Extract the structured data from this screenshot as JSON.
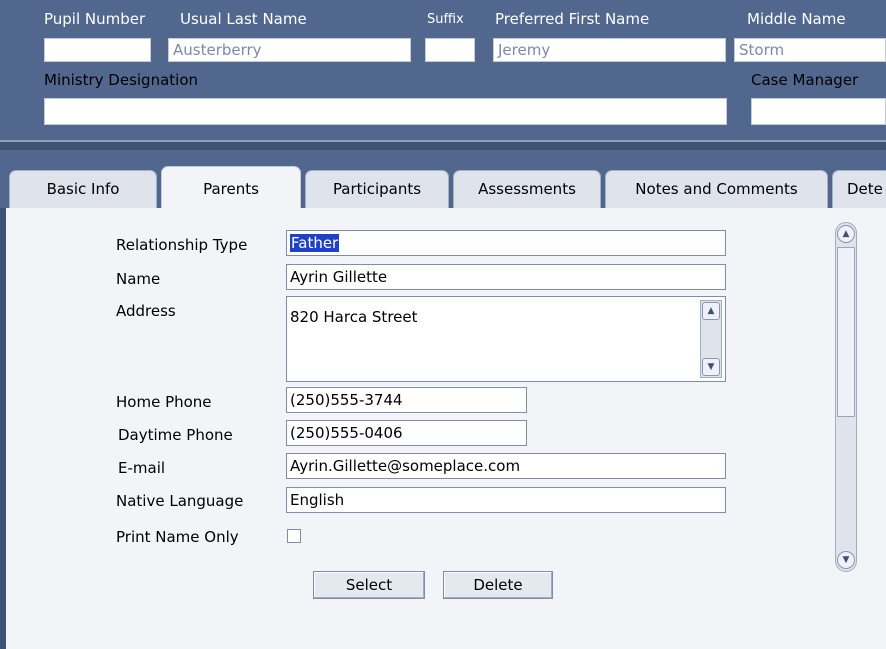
{
  "header": {
    "pupil_number_label": "Pupil Number",
    "pupil_number_value": "",
    "usual_last_name_label": "Usual Last Name",
    "usual_last_name_value": "Austerberry",
    "suffix_label": "Suffix",
    "suffix_value": "",
    "preferred_first_name_label": "Preferred First Name",
    "preferred_first_name_value": "Jeremy",
    "middle_name_label": "Middle Name",
    "middle_name_value": "Storm",
    "ministry_designation_label": "Ministry Designation",
    "ministry_designation_value": "",
    "case_manager_label": "Case Manager",
    "case_manager_value": ""
  },
  "tabs": [
    {
      "label": "Basic Info"
    },
    {
      "label": "Parents"
    },
    {
      "label": "Participants"
    },
    {
      "label": "Assessments"
    },
    {
      "label": "Notes and Comments"
    },
    {
      "label": "Dete"
    }
  ],
  "active_tab": "Parents",
  "form": {
    "relationship_type_label": "Relationship Type",
    "relationship_type_value": "Father",
    "name_label": "Name",
    "name_value": "Ayrin Gillette",
    "address_label": "Address",
    "address_value": "820 Harca  Street",
    "home_phone_label": "Home Phone",
    "home_phone_value": "(250)555-3744",
    "daytime_phone_label": "Daytime Phone",
    "daytime_phone_value": "(250)555-0406",
    "email_label": "E-mail",
    "email_value": "Ayrin.Gillette@someplace.com",
    "native_language_label": "Native Language",
    "native_language_value": "English",
    "print_name_only_label": "Print Name Only",
    "print_name_only_checked": false
  },
  "buttons": {
    "select_label": "Select",
    "delete_label": "Delete"
  },
  "colors": {
    "header_bg": "#52678e",
    "panel_bg": "#f2f4f8",
    "selection": "#1e41c8"
  }
}
